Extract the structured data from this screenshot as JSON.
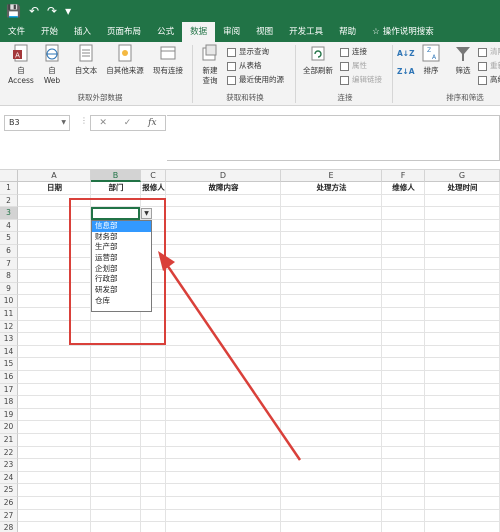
{
  "ribbon_tabs": [
    "文件",
    "开始",
    "插入",
    "页面布局",
    "公式",
    "数据",
    "审阅",
    "视图",
    "开发工具",
    "帮助",
    "操作说明搜索"
  ],
  "active_tab": "数据",
  "ribbon": {
    "get_external": {
      "from_access": "自 Access",
      "from_web_1": "自",
      "from_web_2": "Web",
      "from_text": "自文本",
      "from_other": "自其他来源",
      "existing_conn": "现有连接",
      "group": "获取外部数据"
    },
    "transform": {
      "new_query_1": "新建",
      "new_query_2": "查询",
      "show_queries": "显示查询",
      "from_table": "从表格",
      "recent_sources": "最近使用的源",
      "group": "获取和转换"
    },
    "connections": {
      "refresh_all": "全部刷新",
      "connections": "连接",
      "properties": "属性",
      "edit_links": "编辑链接",
      "group": "连接"
    },
    "sort_filter": {
      "sort": "排序",
      "filter": "筛选",
      "clear": "清除",
      "reapply": "重新应用",
      "advanced": "高级",
      "group": "排序和筛选"
    }
  },
  "formula_bar": {
    "name_box": "B3",
    "fx": "fx"
  },
  "columns": [
    "A",
    "B",
    "C",
    "D",
    "E",
    "F",
    "G"
  ],
  "selected_column": "B",
  "rows": [
    "1",
    "2",
    "3",
    "4",
    "5",
    "6",
    "7",
    "8",
    "9",
    "10",
    "11",
    "12",
    "13",
    "14",
    "15",
    "16",
    "17",
    "18",
    "19",
    "20",
    "21",
    "22",
    "23",
    "24",
    "25",
    "26",
    "27",
    "28"
  ],
  "selected_row": "3",
  "headers": [
    "日期",
    "部门",
    "报修人",
    "故障内容",
    "处理方法",
    "维修人",
    "处理时间"
  ],
  "dropdown": {
    "options": [
      "信息部",
      "财务部",
      "生产部",
      "运营部",
      "企划部",
      "行政部",
      "研发部",
      "仓库"
    ],
    "highlighted": "信息部"
  },
  "colors": {
    "excel_green": "#217346",
    "highlight_blue": "#3399ff",
    "annotation_red": "#d9403a"
  }
}
